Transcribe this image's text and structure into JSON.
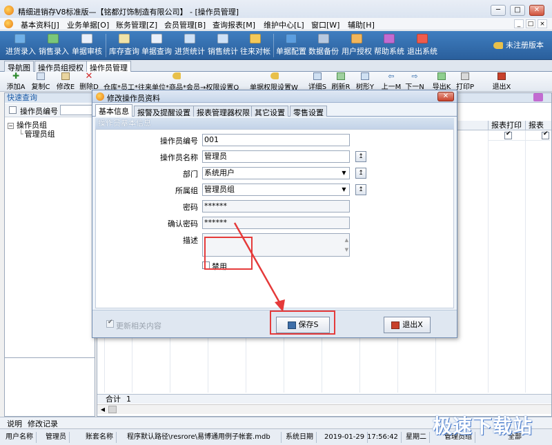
{
  "window": {
    "title": "精细进销存V8标准版—【铭都灯饰制造有限公司】 - [操作员管理]"
  },
  "menubar": {
    "items": [
      "基本资料[J]",
      "业务单据[O]",
      "账务管理[Z]",
      "会员管理[B]",
      "查询报表[M]",
      "维护中心[L]",
      "窗口[W]",
      "辅助[H]"
    ]
  },
  "toolbar": {
    "items": [
      "进货录入",
      "销售录入",
      "单据审核",
      "库存查询",
      "单据查询",
      "进货统计",
      "销售统计",
      "往来对帐",
      "单据配置",
      "数据备份",
      "用户授权",
      "帮助系统",
      "退出系统"
    ],
    "unregistered": "未注册版本"
  },
  "doc_tabs": [
    "导航图",
    "操作员组授权",
    "操作员管理"
  ],
  "toolbar2": {
    "left": [
      "添加A",
      "复制C",
      "修改E",
      "删除D"
    ],
    "middle": "仓库*员工*往来单位*商品*会员→权限设置Q",
    "middle2": "单据权限设置W",
    "right": [
      "详细S",
      "刷新R",
      "树形Y",
      "上一M",
      "下一N",
      "导出K",
      "打印P",
      "退出X"
    ]
  },
  "left_panel": {
    "header": "快速查询",
    "search_label": "操作员编号",
    "tree": [
      "操作员组",
      "管理员组"
    ]
  },
  "grid": {
    "columns": [
      "报表打印",
      "报表"
    ],
    "sum_label": "合计",
    "sum_value": "1"
  },
  "bottom_tabs": [
    "说明",
    "修改记录"
  ],
  "status": {
    "cells": [
      "用户名称",
      "管理员",
      "账套名称",
      "程序默认路径\\resrore\\易博通用例子帐套.mdb",
      "系统日期",
      "2019-01-29",
      "17:56:42",
      "星期二",
      "管理员组",
      "全部"
    ]
  },
  "dialog": {
    "title": "修改操作员资料",
    "tabs": [
      "基本信息",
      "报警及提醒设置",
      "报表管理器权限",
      "其它设置",
      "零售设置"
    ],
    "section": "操作员基本信息",
    "fields": {
      "code_label": "操作员编号",
      "code_value": "001",
      "name_label": "操作员名称",
      "name_value": "管理员",
      "dept_label": "部门",
      "dept_value": "系统用户",
      "group_label": "所属组",
      "group_value": "管理员组",
      "pwd_label": "密码",
      "pwd_value": "******",
      "confirm_label": "确认密码",
      "confirm_value": "******",
      "desc_label": "描述",
      "disabled_label": "禁用"
    },
    "update_related_label": "更新相关内容",
    "save_label": "保存S",
    "exit_label": "退出X"
  },
  "watermark": "极速下载站",
  "colors": {
    "toolbar_blue": "#2f6aab",
    "highlight_red": "#e53a3a"
  }
}
